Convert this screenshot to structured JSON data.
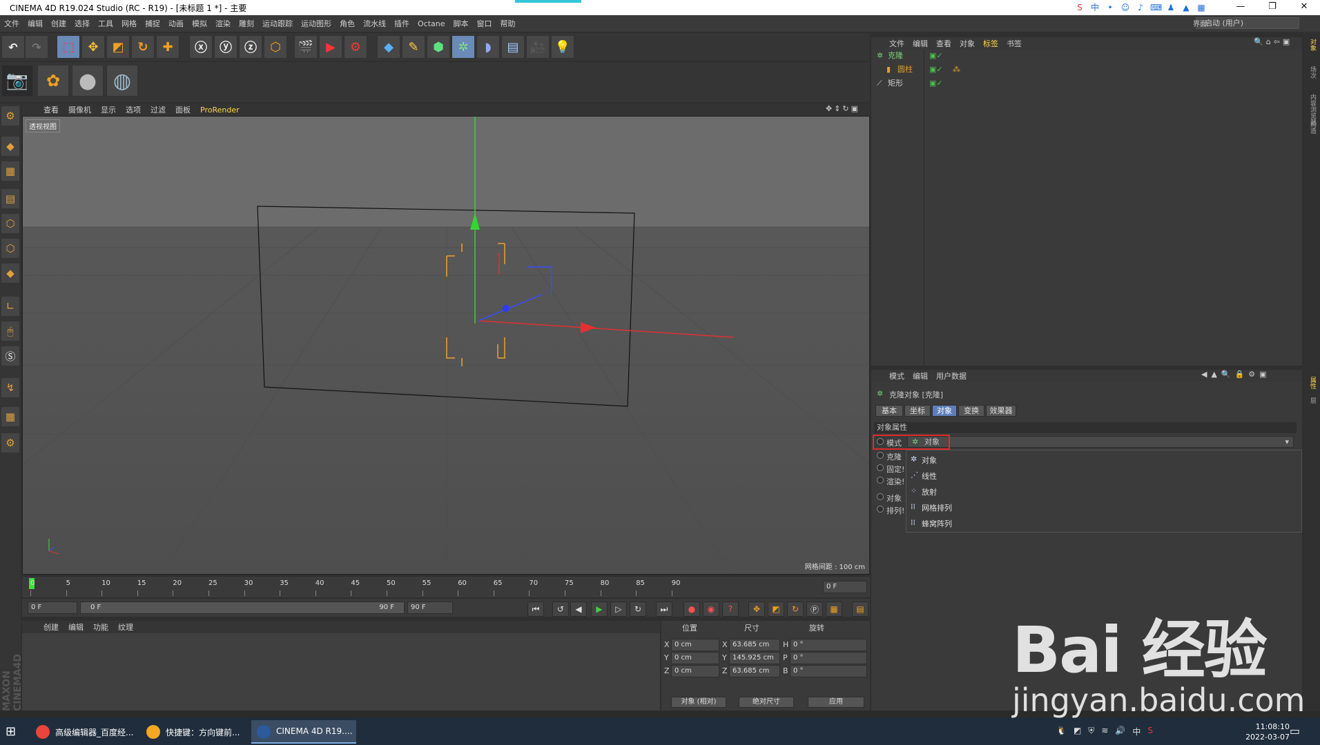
{
  "window": {
    "title": "CINEMA 4D R19.024 Studio (RC - R19) - [未标题 1 *] - 主要",
    "min": "—",
    "max": "❐",
    "close": "✕"
  },
  "menu": [
    "文件",
    "编辑",
    "创建",
    "选择",
    "工具",
    "网格",
    "捕捉",
    "动画",
    "模拟",
    "渲染",
    "雕刻",
    "运动跟踪",
    "运动图形",
    "角色",
    "流水线",
    "插件",
    "Octane",
    "脚本",
    "窗口",
    "帮助"
  ],
  "interface": {
    "label": "界面:",
    "value": "启动 (用户)"
  },
  "viewport": {
    "menu": [
      "查看",
      "摄像机",
      "显示",
      "选项",
      "过滤",
      "面板",
      "ProRender"
    ],
    "label": "透视视图",
    "grid_note": "网格间距 : 100 cm"
  },
  "timeline": {
    "ticks": [
      "0",
      "5",
      "10",
      "15",
      "20",
      "25",
      "30",
      "35",
      "40",
      "45",
      "50",
      "55",
      "60",
      "65",
      "70",
      "75",
      "80",
      "85",
      "90"
    ],
    "end_field": "0 F",
    "current": "0 F",
    "range_start": "0 F",
    "range_end": "90 F",
    "max_field": "90 F"
  },
  "material": {
    "menu": [
      "创建",
      "编辑",
      "功能",
      "纹理"
    ]
  },
  "coords": {
    "headers": {
      "pos": "位置",
      "size": "尺寸",
      "rot": "旋转"
    },
    "rows": [
      {
        "axis": "X",
        "pos": "0 cm",
        "size_axis": "X",
        "size": "63.685 cm",
        "rot_axis": "H",
        "rot": "0 °"
      },
      {
        "axis": "Y",
        "pos": "0 cm",
        "size_axis": "Y",
        "size": "145.925 cm",
        "rot_axis": "P",
        "rot": "0 °"
      },
      {
        "axis": "Z",
        "pos": "0 cm",
        "size_axis": "Z",
        "size": "63.685 cm",
        "rot_axis": "B",
        "rot": "0 °"
      }
    ],
    "mode": "对象 (相对)",
    "sizing": "绝对尺寸",
    "apply": "应用"
  },
  "objects": {
    "menu": [
      "文件",
      "编辑",
      "查看",
      "对象",
      "标签",
      "书签"
    ],
    "items": [
      {
        "name": "克隆",
        "color": "#7ad07a"
      },
      {
        "name": "圆柱",
        "color": "#e0a030"
      },
      {
        "name": "矩形",
        "color": "#cfcfcf"
      }
    ]
  },
  "attributes": {
    "menu": [
      "模式",
      "编辑",
      "用户数据"
    ],
    "title": "克隆对象 [克隆]",
    "tabs": [
      "基本",
      "坐标",
      "对象",
      "变换",
      "效果器"
    ],
    "active_tab": "对象",
    "section": "对象属性",
    "mode_label": "模式",
    "mode_value": "对象",
    "props": [
      "克隆",
      "固定!",
      "渲染!",
      "对象",
      "排列!"
    ],
    "dropdown": [
      "对象",
      "线性",
      "放射",
      "网格排列",
      "蜂窝阵列"
    ]
  },
  "right_tabs": [
    "对象",
    "场次",
    "内容浏览器",
    "构造"
  ],
  "attr_side_tabs": [
    "属性",
    "层"
  ],
  "taskbar": {
    "items": [
      {
        "label": "高级编辑器_百度经...",
        "color": "#e8453c"
      },
      {
        "label": "快捷键：方向键前...",
        "color": "#f5a623"
      },
      {
        "label": "CINEMA 4D R19....",
        "color": "#2c5a9c"
      }
    ],
    "time": "11:08:10",
    "date": "2022-03-07",
    "ime": "中"
  },
  "watermark": {
    "brand": "Bai 经验",
    "url": "jingyan.baidu.com"
  },
  "accent": "#5d7fb6",
  "highlight": "#e02a2a"
}
